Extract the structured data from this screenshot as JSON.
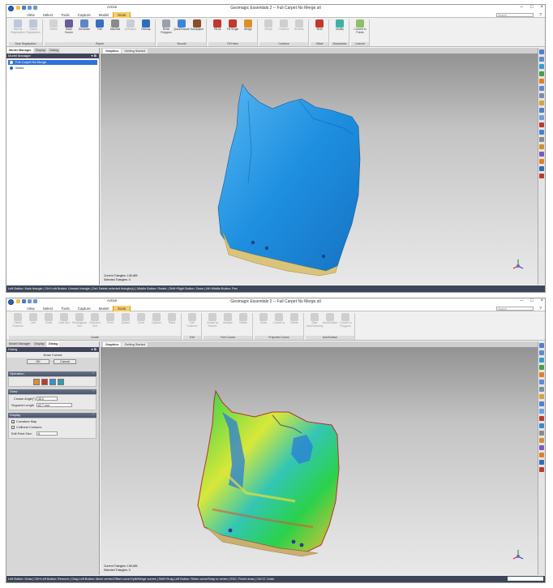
{
  "app_title": "Geomagic Essentials 2 -- Full Carpet No Merge.stl",
  "context_label": "Active",
  "search_placeholder": "Search",
  "menu_tabs": [
    "View",
    "Select",
    "Tools",
    "Capture",
    "Model"
  ],
  "screen1": {
    "context_tab": "Scan",
    "ribbon_groups": [
      {
        "name": "Scan Registration",
        "items": [
          {
            "label": "Manual Registration",
            "color": "#7a96b8",
            "dim": true
          },
          {
            "label": "Global Registration",
            "color": "#7a96b8",
            "dim": true
          }
        ]
      },
      {
        "name": "Repair",
        "items": [
          {
            "label": "Delete",
            "color": "#b0b0b0",
            "dim": true
          },
          {
            "label": "Mesh Doctor",
            "color": "#6c5b9a",
            "dim": false
          },
          {
            "label": "Decimate",
            "color": "#5b88c9",
            "dim": false
          },
          {
            "label": "Trim",
            "color": "#3a6cc4",
            "dim": false
          },
          {
            "label": "Manifold",
            "color": "#8a8a8a",
            "dim": false
          },
          {
            "label": "Defeature",
            "color": "#9aa6bd",
            "dim": true
          },
          {
            "label": "Rewrap",
            "color": "#2e6eb8",
            "dim": false
          }
        ]
      },
      {
        "name": "Smooth",
        "items": [
          {
            "label": "Relax Polygons",
            "color": "#9aa0a8",
            "dim": false
          },
          {
            "label": "QuickSmooth",
            "color": "#3d86d6",
            "dim": false
          },
          {
            "label": "Sandpaper",
            "color": "#8a4f2a",
            "dim": false
          }
        ]
      },
      {
        "name": "Fill Holes",
        "items": [
          {
            "label": "Fill All",
            "color": "#c0392b",
            "dim": false
          },
          {
            "label": "Fill Single",
            "color": "#c0392b",
            "dim": false
          },
          {
            "label": "Bridge",
            "color": "#e08e2b",
            "dim": false
          }
        ]
      },
      {
        "name": "Combine",
        "items": [
          {
            "label": "Merge",
            "color": "#a7a7a7",
            "dim": true
          },
          {
            "label": "Combine",
            "color": "#a7a7a7",
            "dim": true
          },
          {
            "label": "Boolean",
            "color": "#a7a7a7",
            "dim": true
          }
        ]
      },
      {
        "name": "Offset",
        "items": [
          {
            "label": "Shell",
            "color": "#c0392b",
            "dim": false
          }
        ]
      },
      {
        "name": "Boundaries",
        "items": [
          {
            "label": "Modify",
            "color": "#3fb2a4",
            "dim": false
          }
        ]
      },
      {
        "name": "Convert",
        "items": [
          {
            "label": "Convert to Points",
            "color": "#8fbf6a",
            "dim": false
          }
        ]
      }
    ],
    "panel_tabs": [
      "Model Manager",
      "Display",
      "Dialog"
    ],
    "panel_active": "Model Manager",
    "panel_title": "Model Manager",
    "tree": [
      {
        "label": "Full Carpet No Merge",
        "selected": true
      },
      {
        "label": "World",
        "selected": false
      }
    ],
    "view_tabs": [
      "Graphics",
      "Getting Started"
    ],
    "current_triangles": "Current Triangles: 138,485",
    "selected_triangles": "Selected Triangles: 0",
    "status": "Left Button: Mark triangle | Ctrl+Left Button: Unmark triangle | Del: Delete selected triangle(s) | Middle Button: Rotate | Shift+Right Button: Zoom | Alt+Middle Button: Pan"
  },
  "screen2": {
    "context_tab": "Scan",
    "ribbon_groups": [
      {
        "name": "Create",
        "items": [
          {
            "label": "Delete Features",
            "color": "#a6a6a6",
            "dim": true
          },
          {
            "label": "Line",
            "color": "#a6a6a6",
            "dim": true
          },
          {
            "label": "Circle",
            "color": "#a6a6a6",
            "dim": true
          },
          {
            "label": "Oval Slot",
            "color": "#a6a6a6",
            "dim": true
          },
          {
            "label": "Rectangular Slot",
            "color": "#a6a6a6",
            "dim": true
          },
          {
            "label": "Rounded Slot",
            "color": "#a6a6a6",
            "dim": true
          },
          {
            "label": "Point",
            "color": "#a6a6a6",
            "dim": true
          },
          {
            "label": "Sphere",
            "color": "#a6a6a6",
            "dim": true
          },
          {
            "label": "Cone",
            "color": "#a6a6a6",
            "dim": true
          },
          {
            "label": "Cylinder",
            "color": "#a6a6a6",
            "dim": true
          },
          {
            "label": "Plane",
            "color": "#a6a6a6",
            "dim": true
          }
        ]
      },
      {
        "name": "Edit",
        "items": [
          {
            "label": "Edit Features",
            "color": "#a6a6a6",
            "dim": true
          }
        ]
      },
      {
        "name": "Free Curves",
        "items": [
          {
            "label": "Create by Section",
            "color": "#a6a6a6",
            "dim": true
          },
          {
            "label": "Analyze",
            "color": "#a6a6a6",
            "dim": true
          },
          {
            "label": "Delete",
            "color": "#a6a6a6",
            "dim": true
          }
        ]
      },
      {
        "name": "Projected Curves",
        "items": [
          {
            "label": "Draw",
            "color": "#a6a6a6",
            "dim": true
          },
          {
            "label": "Convert to",
            "color": "#a6a6a6",
            "dim": true
          },
          {
            "label": "Delete",
            "color": "#a6a6a6",
            "dim": true
          }
        ]
      },
      {
        "name": "AutoSurface",
        "items": [
          {
            "label": "Start AutoSurfacing",
            "color": "#a6a6a6",
            "dim": true
          },
          {
            "label": "AutoSurface",
            "color": "#a6a6a6",
            "dim": true
          },
          {
            "label": "Convert to Polygons",
            "color": "#a6a6a6",
            "dim": true
          }
        ]
      }
    ],
    "panel_tabs": [
      "Model Manager",
      "Display",
      "Dialog"
    ],
    "panel_active": "Dialog",
    "panel_title": "Dialog",
    "dialog_title": "Draw Curves",
    "ok_label": "OK",
    "cancel_label": "Cancel",
    "operation_header": "Operation",
    "operation_buttons": [
      "#e08e2b",
      "#c0392b",
      "#3a8fc9",
      "#2ca0a8"
    ],
    "ortho_header": "Draw",
    "crease_label": "Crease Angle(°)",
    "crease_value": "45.0",
    "segment_label": "Segment Length",
    "segment_value": "62.7 mm",
    "display_header": "Display",
    "curvature_label": "Curvature Map",
    "colinear_label": "Collinear Contours",
    "edit_point_label": "Edit Point Size:",
    "edit_point_value": "8",
    "view_tabs": [
      "Graphics",
      "Getting Started"
    ],
    "current_triangles": "Current Triangles: 138,485",
    "selected_triangles": "Selected Triangles: 0",
    "status": "Left Button: Draw | Ctrl+Left Button: Remove | Drag Left Button: Move vertex/Offset curve/Split/Merge curves | Shift+Drag Left Button: Relax curve/Snap to vertex | ESC: Finish draw | Ctrl+Z: Undo"
  },
  "right_toolbar_colors": [
    "#4f7fd1",
    "#5b8bd6",
    "#2f9fcf",
    "#43a047",
    "#e67e22",
    "#5b8bd6",
    "#7b8ea6",
    "#d9a13b",
    "#4f7fd1",
    "#6aa0e0",
    "#c0392b",
    "#3d86d6",
    "#8a8a8a",
    "#d48f2a",
    "#7e57c2",
    "#e67e22",
    "#2e6eb8",
    "#c0392b"
  ],
  "icons": {
    "app": "geomagic-app-icon",
    "triad": "xyz-axis-triad-icon"
  }
}
